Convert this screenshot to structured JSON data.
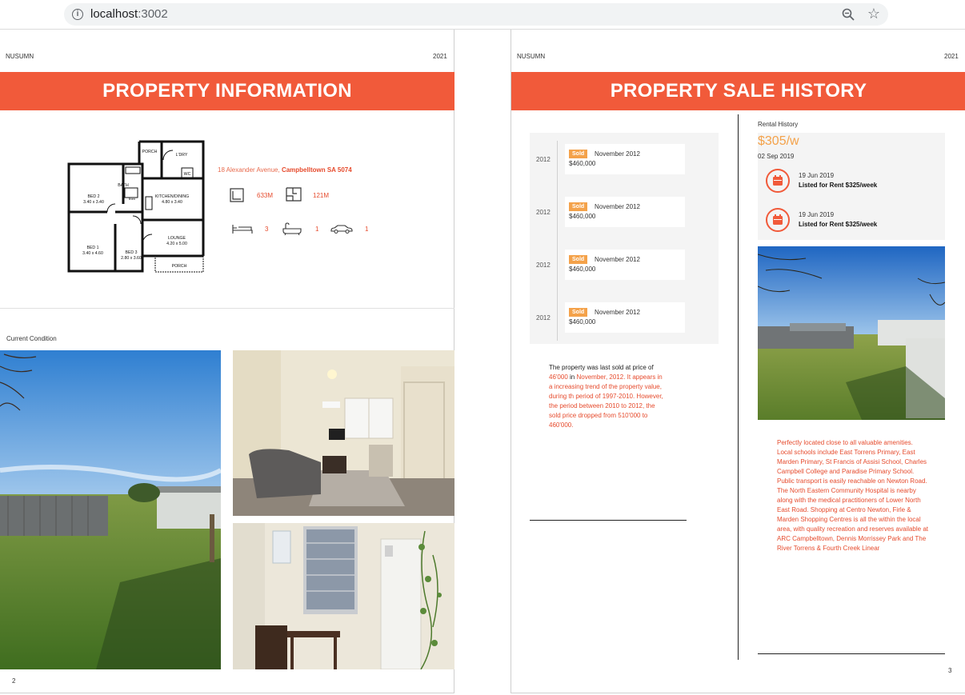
{
  "browser": {
    "url_host": "localhost",
    "url_port": ":3002"
  },
  "left_page": {
    "brand": "NUSUMN",
    "year": "2021",
    "title": "PROPERTY INFORMATION",
    "address_street": "18 Alexander Avenue,",
    "address_suburb": "Campbelltown",
    "address_state": "SA 5074",
    "land_size": "633M",
    "floor_size": "121M",
    "bedrooms": "3",
    "bathrooms": "1",
    "car_spaces": "1",
    "floorplan_labels": {
      "porch_top": "PORCH",
      "ldry": "L'DRY",
      "wc": "WC",
      "bath": "BATH",
      "linen": "linen",
      "bed2": "BED 2",
      "bed2_size": "3.40 x 3.40",
      "kitchen": "KITCHEN/DINING",
      "kitchen_size": "4.80 x 3.40",
      "lounge": "LOUNGE",
      "lounge_size": "4.20 x 5.00",
      "bed1": "BED 1",
      "bed1_size": "3.40 x 4.60",
      "bed3": "BED 3",
      "bed3_size": "2.80 x 3.60",
      "porch_bottom": "PORCH"
    },
    "section_label": "Current Condition",
    "page_number": "2"
  },
  "right_page": {
    "brand": "NUSUMN",
    "year": "2021",
    "title": "PROPERTY SALE HISTORY",
    "sales": [
      {
        "year": "2012",
        "tag": "Sold",
        "date": "November 2012",
        "price": "$460,000"
      },
      {
        "year": "2012",
        "tag": "Sold",
        "date": "November 2012",
        "price": "$460,000"
      },
      {
        "year": "2012",
        "tag": "Sold",
        "date": "November 2012",
        "price": "$460,000"
      },
      {
        "year": "2012",
        "tag": "Sold",
        "date": "November 2012",
        "price": "$460,000"
      }
    ],
    "summary": {
      "intro": "The property was last sold at price of",
      "price": "46'000",
      "in": "in",
      "date": "November, 2012.",
      "rest": "It appears in a increasing trend of the property value, during th period of 1997-2010. However, the period between 2010 to 2012, the sold price dropped from 510'000 to 460'000."
    },
    "rental_label": "Rental History",
    "rent_price": "$305/w",
    "rent_date": "02 Sep 2019",
    "rental_events": [
      {
        "date": "19 Jun 2019",
        "text": "Listed for Rent $325/week"
      },
      {
        "date": "19 Jun 2019",
        "text": "Listed for Rent $325/week"
      }
    ],
    "description": "Perfectly located close to all valuable amenities. Local schools include East Torrens Primary, East Marden Primary, St Francis of Assisi School, Charles Campbell College and Paradise Primary School. Public transport is easily reachable on Newton Road. The North Eastern Community Hospital is nearby along with the medical practitioners of Lower North East Road. Shopping at Centro Newton, Firle & Marden Shopping Centres is all the within the local area, with quality recreation and reserves available at ARC Campbelltown, Dennis Morrissey Park and The River Torrens & Fourth Creek Linear",
    "page_number": "3"
  },
  "colors": {
    "accent": "#f15a3a",
    "sold_tag": "#f4a24a",
    "rent_price": "#f4a24a"
  }
}
